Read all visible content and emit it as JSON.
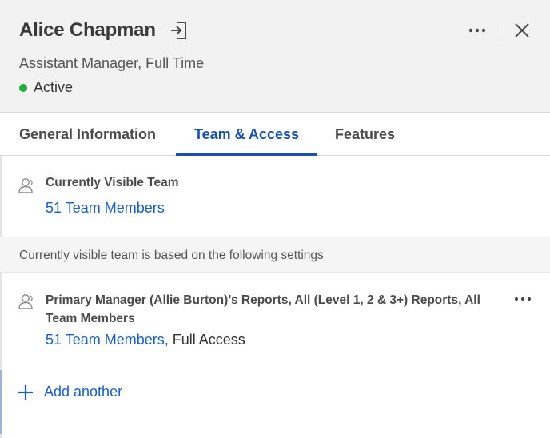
{
  "header": {
    "name": "Alice Chapman",
    "job_title": "Assistant Manager, Full Time",
    "status_label": "Active",
    "status_color": "#1cb23a",
    "icons": {
      "login": "login-icon",
      "more": "more-horizontal-icon",
      "close": "close-icon"
    }
  },
  "tabs": [
    {
      "label": "General Information",
      "active": false
    },
    {
      "label": "Team & Access",
      "active": true
    },
    {
      "label": "Features",
      "active": false
    }
  ],
  "visible_team": {
    "icon": "people-icon",
    "title": "Currently Visible Team",
    "link_text": "51 Team Members"
  },
  "note": "Currently visible team is based on the following settings",
  "settings": [
    {
      "icon": "people-icon",
      "title": "Primary Manager (Allie Burton)’s Reports, All (Level 1, 2 & 3+) Reports, All Team Members",
      "link_text": "51 Team Members,",
      "access": "Full Access"
    }
  ],
  "add_another": {
    "icon": "plus-icon",
    "label": "Add another"
  },
  "colors": {
    "accent": "#1a4fb5",
    "link": "#1a5fc6",
    "header_bg": "#f2f2f3"
  }
}
